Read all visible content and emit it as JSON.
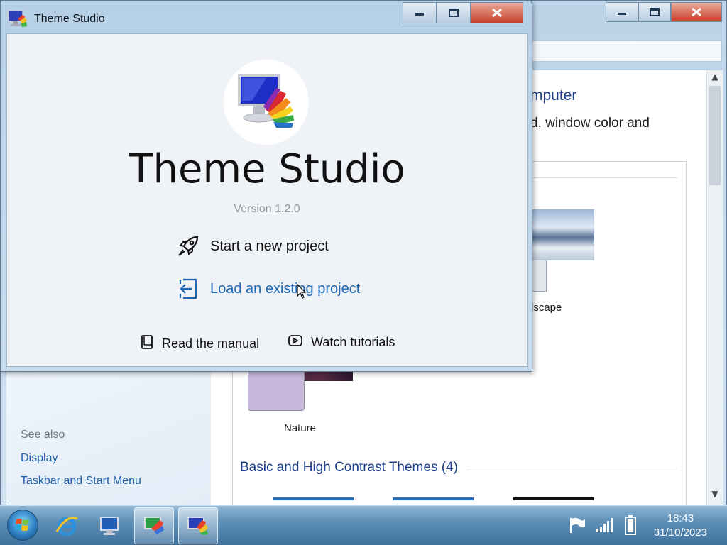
{
  "background_window": {
    "heading": "mputer",
    "description": "d, window color and",
    "themes": {
      "landscape_label": "dscape",
      "nature_label": "Nature",
      "basic_section_title": "Basic and High Contrast Themes (4)"
    },
    "sidebar": {
      "see_also": "See also",
      "links": [
        "Display",
        "Taskbar and Start Menu"
      ]
    },
    "caption_buttons": [
      "minimize",
      "maximize",
      "close"
    ]
  },
  "theme_studio": {
    "window_title": "Theme Studio",
    "app_name": "Theme Studio",
    "version": "Version 1.2.0",
    "actions": {
      "start_new": "Start a new project",
      "load_existing": "Load an existing project"
    },
    "links": {
      "manual": "Read the manual",
      "tutorials": "Watch tutorials"
    },
    "caption_buttons": [
      "minimize",
      "maximize",
      "close"
    ]
  },
  "taskbar": {
    "items": [
      "start-orb",
      "internet-explorer-icon",
      "computer-icon",
      "personalization-icon",
      "theme-studio-icon"
    ],
    "tray_icons": [
      "flag-icon",
      "network-icon",
      "battery-icon"
    ],
    "time": "18:43",
    "date": "31/10/2023"
  },
  "colors": {
    "link_blue": "#1d68b4",
    "heading_blue": "#1e3f8a",
    "client_bg": "#eff2f6"
  }
}
